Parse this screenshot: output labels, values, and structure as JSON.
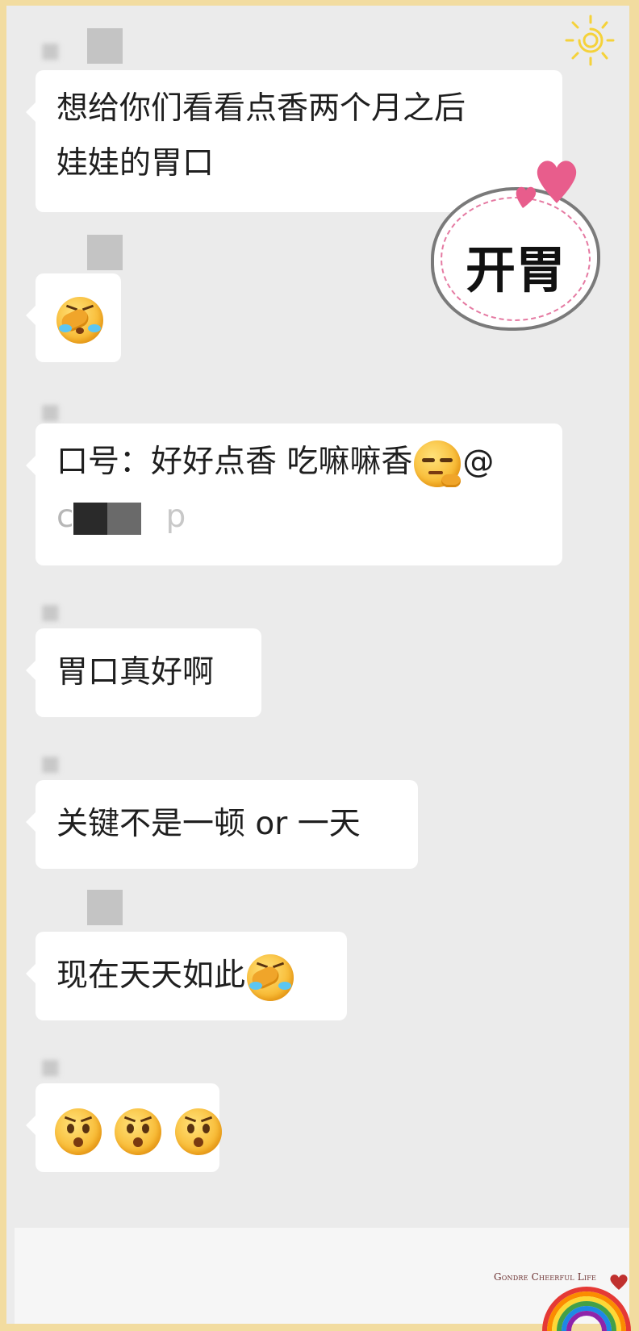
{
  "messages": [
    {
      "text_lines": [
        "想给你们看看点香两个月之后",
        "娃娃的胃口"
      ]
    },
    {
      "emojis": [
        "facepalm-emoji"
      ]
    },
    {
      "text": "口号：好好点香 吃嘛嘛香",
      "emoji": "smirk-emoji",
      "suffix": "@",
      "mention_first": "c",
      "mention_last": "p"
    },
    {
      "text": "胃口真好啊"
    },
    {
      "text": "关键不是一顿 or 一天"
    },
    {
      "text": "现在天天如此",
      "emoji": "facepalm-emoji"
    },
    {
      "emojis": [
        "stunned-emoji",
        "stunned-emoji",
        "stunned-emoji"
      ]
    }
  ],
  "sticker": {
    "label": "开胃"
  },
  "watermark": {
    "brand": "Gondre Cheerful Life"
  },
  "colors": {
    "accent_pink": "#e85d8c",
    "bubble": "#ffffff",
    "chat_bg": "#ebebeb",
    "frame": "#f2dca0"
  }
}
